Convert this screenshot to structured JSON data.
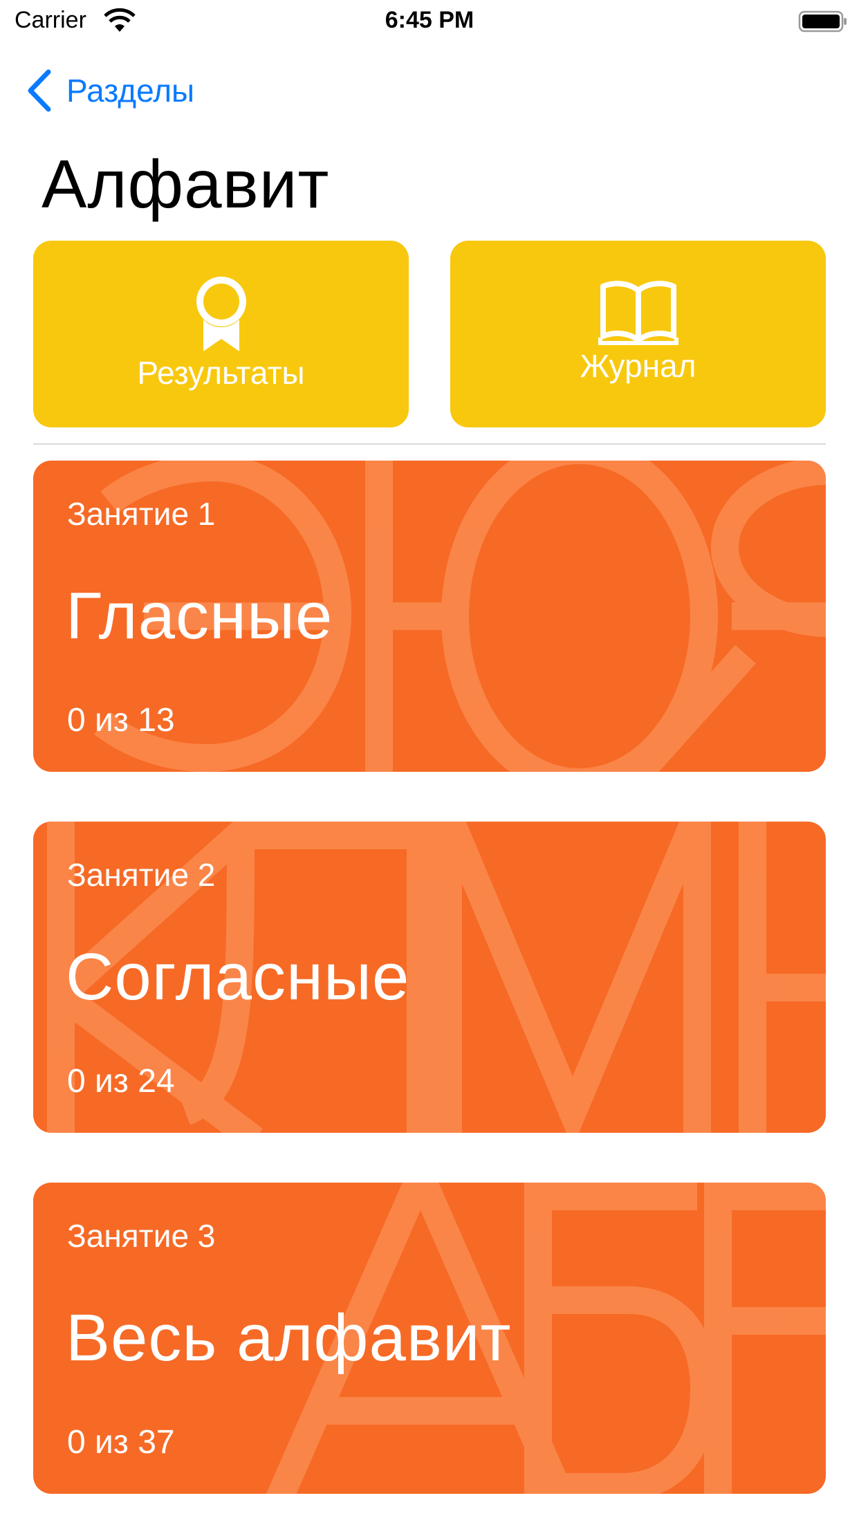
{
  "status_bar": {
    "carrier": "Carrier",
    "time": "6:45 PM"
  },
  "nav": {
    "back_label": "Разделы",
    "title": "Алфавит"
  },
  "quick_actions": {
    "results_label": "Результаты",
    "journal_label": "Журнал",
    "color": "#f8c80e"
  },
  "lessons": [
    {
      "kicker": "Занятие 1",
      "title": "Гласные",
      "progress": "0 из 13"
    },
    {
      "kicker": "Занятие 2",
      "title": "Согласные",
      "progress": "0 из 24"
    },
    {
      "kicker": "Занятие 3",
      "title": "Весь алфавит",
      "progress": "0 из 37"
    }
  ],
  "colors": {
    "accent": "#0a7aff",
    "card": "#f66a26",
    "card_letters": "#fb8a4e"
  }
}
